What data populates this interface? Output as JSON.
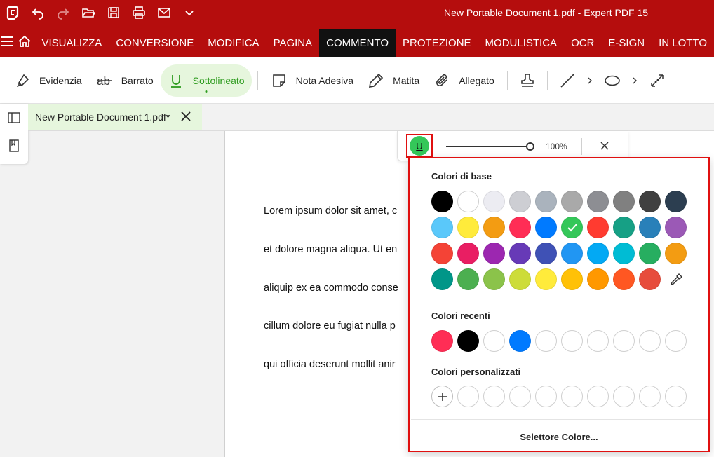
{
  "window": {
    "title": "New Portable Document 1.pdf   -   Expert PDF 15"
  },
  "menu": {
    "items": [
      "VISUALIZZA",
      "CONVERSIONE",
      "MODIFICA",
      "PAGINA",
      "COMMENTO",
      "PROTEZIONE",
      "MODULISTICA",
      "OCR",
      "E-SIGN",
      "IN LOTTO"
    ],
    "active": "COMMENTO"
  },
  "ribbon": {
    "highlight": "Evidenzia",
    "strike": "Barrato",
    "underline": "Sottolineato",
    "sticky_note": "Nota Adesiva",
    "pencil": "Matita",
    "attachment": "Allegato"
  },
  "tab": {
    "label": "New Portable Document 1.pdf*"
  },
  "document": {
    "lines": [
      "Lorem ipsum dolor sit amet, c",
      "et dolore magna aliqua. Ut en",
      "aliquip ex ea commodo conse",
      "cillum dolore eu fugiat nulla p",
      "qui officia deserunt mollit anir"
    ]
  },
  "floatbar": {
    "underline_glyph": "U",
    "zoom": "100%",
    "zoom_fraction": 1.0
  },
  "colors": {
    "brand": "#b50d0d",
    "selected_swatch": "#34c759",
    "accent_green": "#2e9c1f",
    "highlight_border": "#e01010"
  },
  "popup": {
    "base_title": "Colori di base",
    "recent_title": "Colori recenti",
    "custom_title": "Colori personalizzati",
    "picker_label": "Selettore Colore...",
    "base_colors": [
      "#000000",
      "#ffffff",
      "#ececf2",
      "#cdced3",
      "#aab3bd",
      "#a9a9a9",
      "#8d8e93",
      "#808080",
      "#404040",
      "#2c3e50",
      "#5ac8fa",
      "#ffeb3b",
      "#f39c12",
      "#ff2d55",
      "#007aff",
      "#34c759",
      "#ff3b30",
      "#16a085",
      "#2980b9",
      "#9b59b6",
      "#f44336",
      "#e91e63",
      "#9c27b0",
      "#673ab7",
      "#3f51b5",
      "#2196f3",
      "#03a9f4",
      "#00bcd4",
      "#27ae60",
      "#f39c12",
      "#009688",
      "#4caf50",
      "#8bc34a",
      "#cddc39",
      "#ffeb3b",
      "#ffc107",
      "#ff9800",
      "#ff5722",
      "#e74c3c"
    ],
    "selected_index": 15,
    "recent_colors": [
      "#ff2d55",
      "#000000",
      "#ffffff",
      "#007aff"
    ],
    "recent_slots": 10,
    "custom_slots": 9
  }
}
